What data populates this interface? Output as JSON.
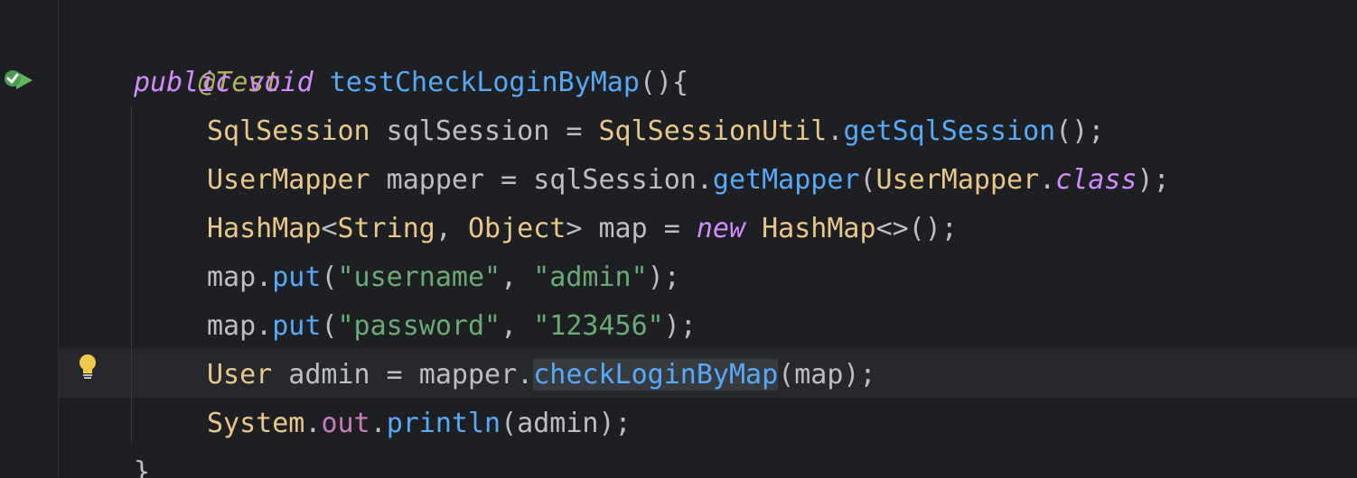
{
  "code": {
    "annotation": "@Test",
    "method_sig": {
      "kw_public": "public",
      "kw_void": "void",
      "name": "testCheckLoginByMap",
      "rest": "(){"
    },
    "l3": {
      "type": "SqlSession",
      "decl": " sqlSession = ",
      "util": "SqlSessionUtil",
      "dot": ".",
      "call": "getSqlSession",
      "rest": "();"
    },
    "l4": {
      "type": "UserMapper",
      "decl": " mapper = sqlSession.",
      "call": "getMapper",
      "open": "(",
      "arg": "UserMapper",
      "dot": ".",
      "kw_class": "class",
      "rest": ");"
    },
    "l5": {
      "type": "HashMap",
      "lt": "<",
      "t1": "String",
      "comma": ", ",
      "t2": "Object",
      "decl": "> map = ",
      "kw_new": "new",
      "sp": " ",
      "ctor": "HashMap",
      "rest": "<>();"
    },
    "l6": {
      "obj": "map.",
      "call": "put",
      "open": "(",
      "s1": "\"username\"",
      "comma": ", ",
      "s2": "\"admin\"",
      "rest": ");"
    },
    "l7": {
      "obj": "map.",
      "call": "put",
      "open": "(",
      "s1": "\"password\"",
      "comma": ", ",
      "s2": "\"123456\"",
      "rest": ");"
    },
    "l8": {
      "type": "User",
      "decl": " admin = mapper.",
      "call": "checkLoginByMap",
      "rest": "(map);"
    },
    "l9": {
      "type": "System",
      "dot": ".",
      "field": "out",
      "dot2": ".",
      "call": "println",
      "rest": "(admin);"
    },
    "l10": "}"
  },
  "icons": {
    "run": "run-test-passed-icon",
    "bulb": "intention-bulb-icon"
  },
  "colors": {
    "background": "#1E1F22",
    "keyword": "#CF8DFB",
    "method": "#56A8F5",
    "class": "#E8C88A",
    "string": "#6AAB73",
    "annotation": "#B3AE60",
    "text": "#BCBEC4"
  }
}
